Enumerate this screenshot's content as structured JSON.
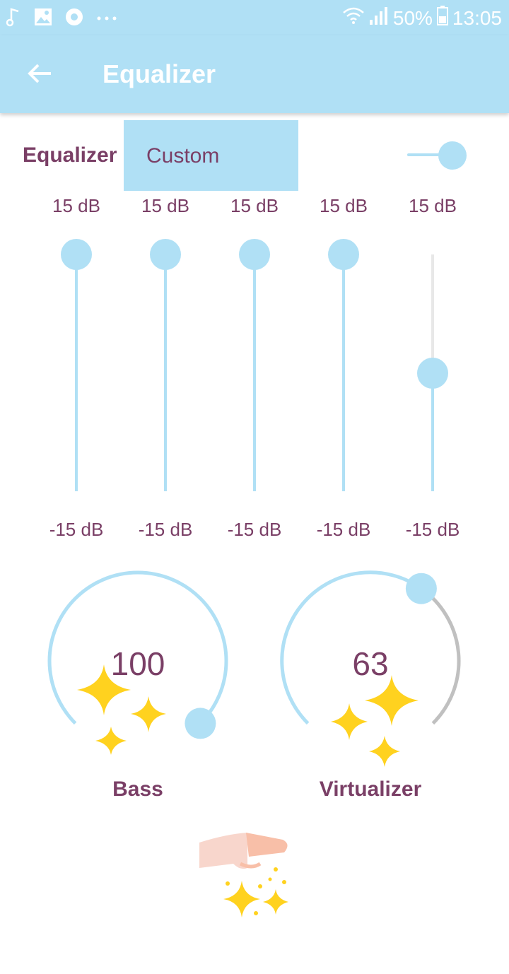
{
  "status": {
    "battery": "50%",
    "time": "13:05",
    "icons": [
      "music-note-icon",
      "image-icon",
      "chrome-icon",
      "more-dots-icon",
      "wifi-icon",
      "signal-icon",
      "battery-icon"
    ]
  },
  "appbar": {
    "title": "Equalizer",
    "back_icon": "arrow-left-icon"
  },
  "equalizer": {
    "label": "Equalizer",
    "preset": "Custom",
    "enabled": true,
    "bands": [
      {
        "max_label": "15 dB",
        "min_label": "-15 dB",
        "value_db": 15
      },
      {
        "max_label": "15 dB",
        "min_label": "-15 dB",
        "value_db": 15
      },
      {
        "max_label": "15 dB",
        "min_label": "-15 dB",
        "value_db": 15
      },
      {
        "max_label": "15 dB",
        "min_label": "-15 dB",
        "value_db": 15
      },
      {
        "max_label": "15 dB",
        "min_label": "-15 dB",
        "value_db": 0
      }
    ]
  },
  "bass": {
    "value": "100",
    "label": "Bass",
    "level": 1.0
  },
  "virtualizer": {
    "value": "63",
    "label": "Virtualizer",
    "level": 0.63
  },
  "colors": {
    "accent": "#b0e0f5",
    "text": "#7a3f66",
    "track_off": "#c0c0c0",
    "sparkle": "#ffd21f"
  }
}
